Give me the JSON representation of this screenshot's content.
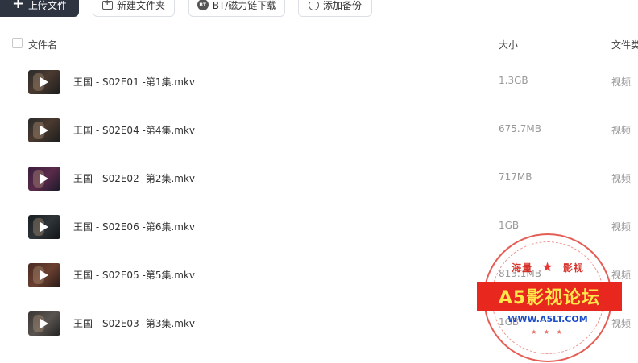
{
  "toolbar": {
    "upload_label": "上传文件",
    "new_folder_label": "新建文件夹",
    "bt_label": "BT/磁力链下载",
    "backup_label": "添加备份"
  },
  "table": {
    "col_name": "文件名",
    "col_size": "大小",
    "col_type": "文件类",
    "rows": [
      {
        "name": "王国 - S02E01 -第1集.mkv",
        "size": "1.3GB",
        "type": "视频"
      },
      {
        "name": "王国 - S02E04 -第4集.mkv",
        "size": "675.7MB",
        "type": "视频"
      },
      {
        "name": "王国 - S02E02 -第2集.mkv",
        "size": "717MB",
        "type": "视频"
      },
      {
        "name": "王国 - S02E06 -第6集.mkv",
        "size": "1GB",
        "type": "视频"
      },
      {
        "name": "王国 - S02E05 -第5集.mkv",
        "size": "813.1MB",
        "type": "视频"
      },
      {
        "name": "王国 - S02E03 -第3集.mkv",
        "size": "1GB",
        "type": "视频"
      }
    ]
  },
  "watermark": {
    "top_left": "海量",
    "top_right": "影视",
    "title": "A5影视论坛",
    "url": "WWW.A5LT.COM"
  },
  "colors": {
    "primary_button": "#2f3441",
    "stamp_red": "#e8281e",
    "stamp_yellow": "#ffe94a",
    "stamp_blue": "#1e4fc8"
  }
}
